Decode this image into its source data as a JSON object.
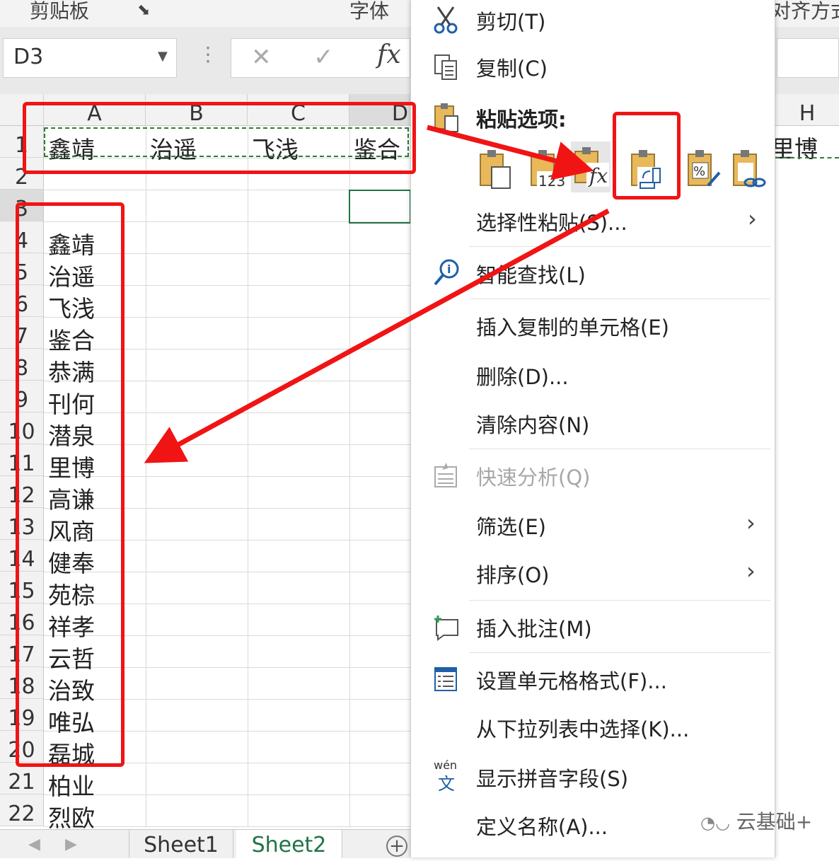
{
  "ribbon": {
    "group_clipboard": "剪贴板",
    "group_font": "字体",
    "group_align": "对齐方式"
  },
  "formula_bar": {
    "name_box": "D3",
    "fx_label": "fx"
  },
  "sheet": {
    "columns": [
      "A",
      "B",
      "C",
      "D"
    ],
    "right_column": "H",
    "rows": [
      "1",
      "2",
      "3",
      "4",
      "5",
      "6",
      "7",
      "8",
      "9",
      "10",
      "11",
      "12",
      "13",
      "14",
      "15",
      "16",
      "17",
      "18",
      "19",
      "20",
      "21",
      "22"
    ],
    "row1_values": [
      "鑫靖",
      "治遥",
      "飞浅",
      "鉴合"
    ],
    "right_cell_value": "里博",
    "column_a_values": [
      "鑫靖",
      "治遥",
      "飞浅",
      "鉴合",
      "恭满",
      "刊何",
      "潜泉",
      "里博",
      "高谦",
      "风商",
      "健奉",
      "苑棕",
      "祥孝",
      "云哲",
      "治致",
      "唯弘",
      "磊城",
      "柏业",
      "烈欧"
    ],
    "tabs": [
      "Sheet1",
      "Sheet2"
    ],
    "active_tab": "Sheet2"
  },
  "context_menu": {
    "cut": "剪切(T)",
    "copy": "复制(C)",
    "paste_options": "粘贴选项:",
    "paste_special": "选择性粘贴(S)...",
    "smart_lookup": "智能查找(L)",
    "insert_copied": "插入复制的单元格(E)",
    "delete": "删除(D)...",
    "clear": "清除内容(N)",
    "quick_analysis": "快速分析(Q)",
    "filter": "筛选(E)",
    "sort": "排序(O)",
    "insert_comment": "插入批注(M)",
    "format_cells": "设置单元格格式(F)...",
    "pick_from_list": "从下拉列表中选择(K)...",
    "phonetic": "显示拼音字段(S)",
    "define_name": "定义名称(A)...",
    "paste_icons": [
      "paste-icon",
      "paste-values-icon",
      "paste-formulas-icon",
      "transpose-icon",
      "paste-formatting-icon",
      "paste-link-icon"
    ],
    "paste_values_label": "123",
    "percent_label": "%",
    "phonetic_icon_text": "wén",
    "phonetic_icon_char": "文"
  },
  "watermark": "云基础+",
  "colors": {
    "annotation_red": "#f01414",
    "excel_green": "#217346",
    "clipboard_gold": "#e8b85a"
  }
}
